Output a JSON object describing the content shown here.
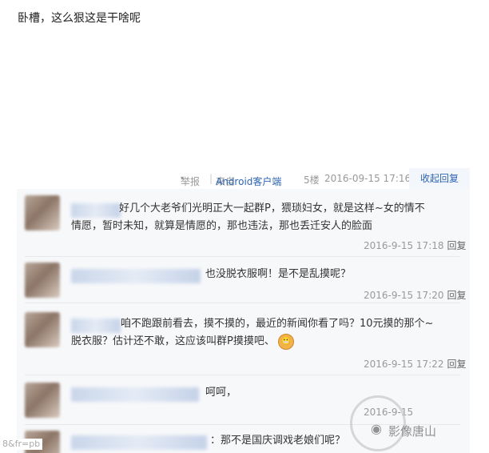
{
  "post": {
    "text": "卧槽，这么狠这是干啥呢",
    "report_label": "举报",
    "caret": "▾",
    "separator": "|",
    "source_prefix": "来自",
    "source_link": "Android客户端",
    "floor": "5楼",
    "time": "2016-09-15 17:16",
    "collapse_label": "收起回复"
  },
  "replies": [
    {
      "content_line1": "好几个大老爷们光明正大一起群P，猥琐妇女，就是这样~女的情不",
      "content_line2": "情愿，暂时未知，就算是情愿的，那也违法，那也丢迁安人的脸面",
      "time": "2016-9-15 17:18",
      "reply_label": "回复"
    },
    {
      "content_line1": "也没脱衣服啊！是不是乱摸呢？",
      "time": "2016-9-15 17:20",
      "reply_label": "回复"
    },
    {
      "content_line1": "咱不跑跟前看去，摸不摸的，最近的新闻你看了吗？10元摸的那个~",
      "content_line2": "脱衣服？估计还不敢，这应该叫群P摸摸吧、",
      "emoji": "😬",
      "time": "2016-9-15 17:22",
      "reply_label": "回复"
    },
    {
      "content_line1": "呵呵，",
      "time": "2016-9-15"
    },
    {
      "content_line1": "：那不是国庆调戏老娘们呢？"
    }
  ],
  "url_snippet": "8&fr=pb",
  "watermark": {
    "text": "影像唐山",
    "icon": "wechat-icon"
  }
}
